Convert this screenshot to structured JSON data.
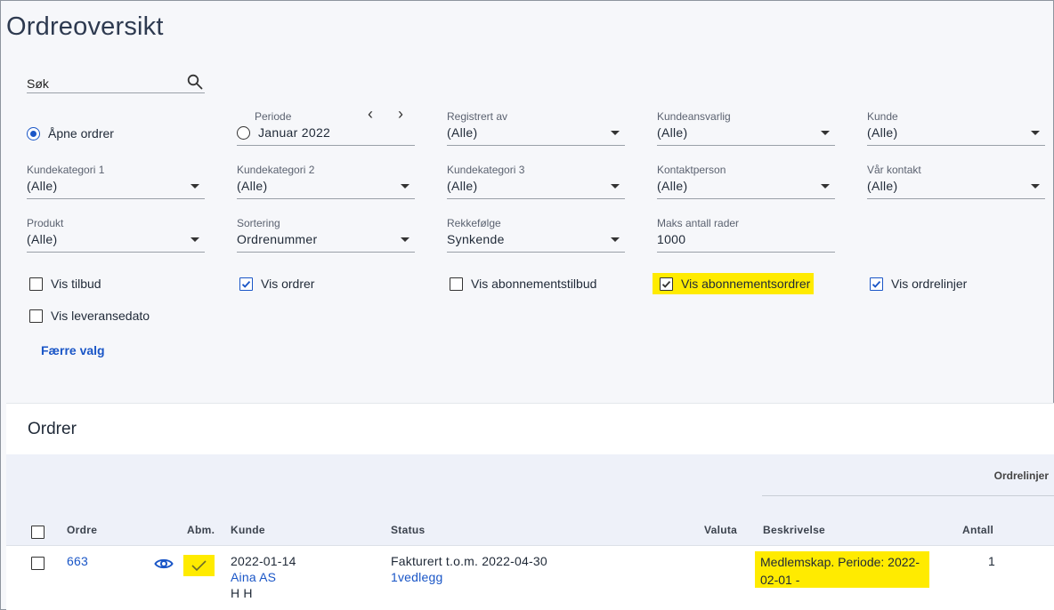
{
  "page": {
    "title": "Ordreoversikt"
  },
  "search": {
    "label": "Søk"
  },
  "filters": {
    "open_orders": {
      "label": "Åpne ordrer",
      "checked": true
    },
    "period": {
      "label": "Periode",
      "value": "Januar 2022",
      "checked": false
    },
    "registered_by": {
      "label": "Registrert av",
      "value": "(Alle)"
    },
    "customer_manager": {
      "label": "Kundeansvarlig",
      "value": "(Alle)"
    },
    "customer": {
      "label": "Kunde",
      "value": "(Alle)"
    },
    "customer_category_1": {
      "label": "Kundekategori 1",
      "value": "(Alle)"
    },
    "customer_category_2": {
      "label": "Kundekategori 2",
      "value": "(Alle)"
    },
    "customer_category_3": {
      "label": "Kundekategori 3",
      "value": "(Alle)"
    },
    "contact_person": {
      "label": "Kontaktperson",
      "value": "(Alle)"
    },
    "our_contact": {
      "label": "Vår kontakt",
      "value": "(Alle)"
    },
    "product": {
      "label": "Produkt",
      "value": "(Alle)"
    },
    "sorting": {
      "label": "Sortering",
      "value": "Ordrenummer"
    },
    "order": {
      "label": "Rekkefølge",
      "value": "Synkende"
    },
    "max_rows": {
      "label": "Maks antall rader",
      "value": "1000"
    }
  },
  "checkboxes": {
    "show_quotes": {
      "label": "Vis tilbud",
      "checked": false
    },
    "show_orders": {
      "label": "Vis ordrer",
      "checked": true
    },
    "show_subscription_quotes": {
      "label": "Vis abonnementstilbud",
      "checked": false
    },
    "show_subscription_orders": {
      "label": "Vis abonnementsordrer",
      "checked": true
    },
    "show_order_lines": {
      "label": "Vis ordrelinjer",
      "checked": true
    },
    "show_delivery_date": {
      "label": "Vis leveransedato",
      "checked": false
    }
  },
  "fewer_options": "Færre valg",
  "orders": {
    "title": "Ordrer",
    "group_header": "Ordrelinjer",
    "columns": {
      "order": "Ordre",
      "abm": "Abm.",
      "customer": "Kunde",
      "status": "Status",
      "currency": "Valuta",
      "description": "Beskrivelse",
      "quantity": "Antall"
    },
    "rows": [
      {
        "order_no": "663",
        "date": "2022-01-14",
        "customer_name": "Aina AS",
        "customer_contact": "H H",
        "status": "Fakturert t.o.m. 2022-04-30",
        "attachments": "1vedlegg",
        "description": "Medlemskap. Periode: 2022-02-01 -",
        "quantity": "1"
      }
    ]
  },
  "colors": {
    "accent": "#1a56c7",
    "highlight": "#ffeb00"
  }
}
